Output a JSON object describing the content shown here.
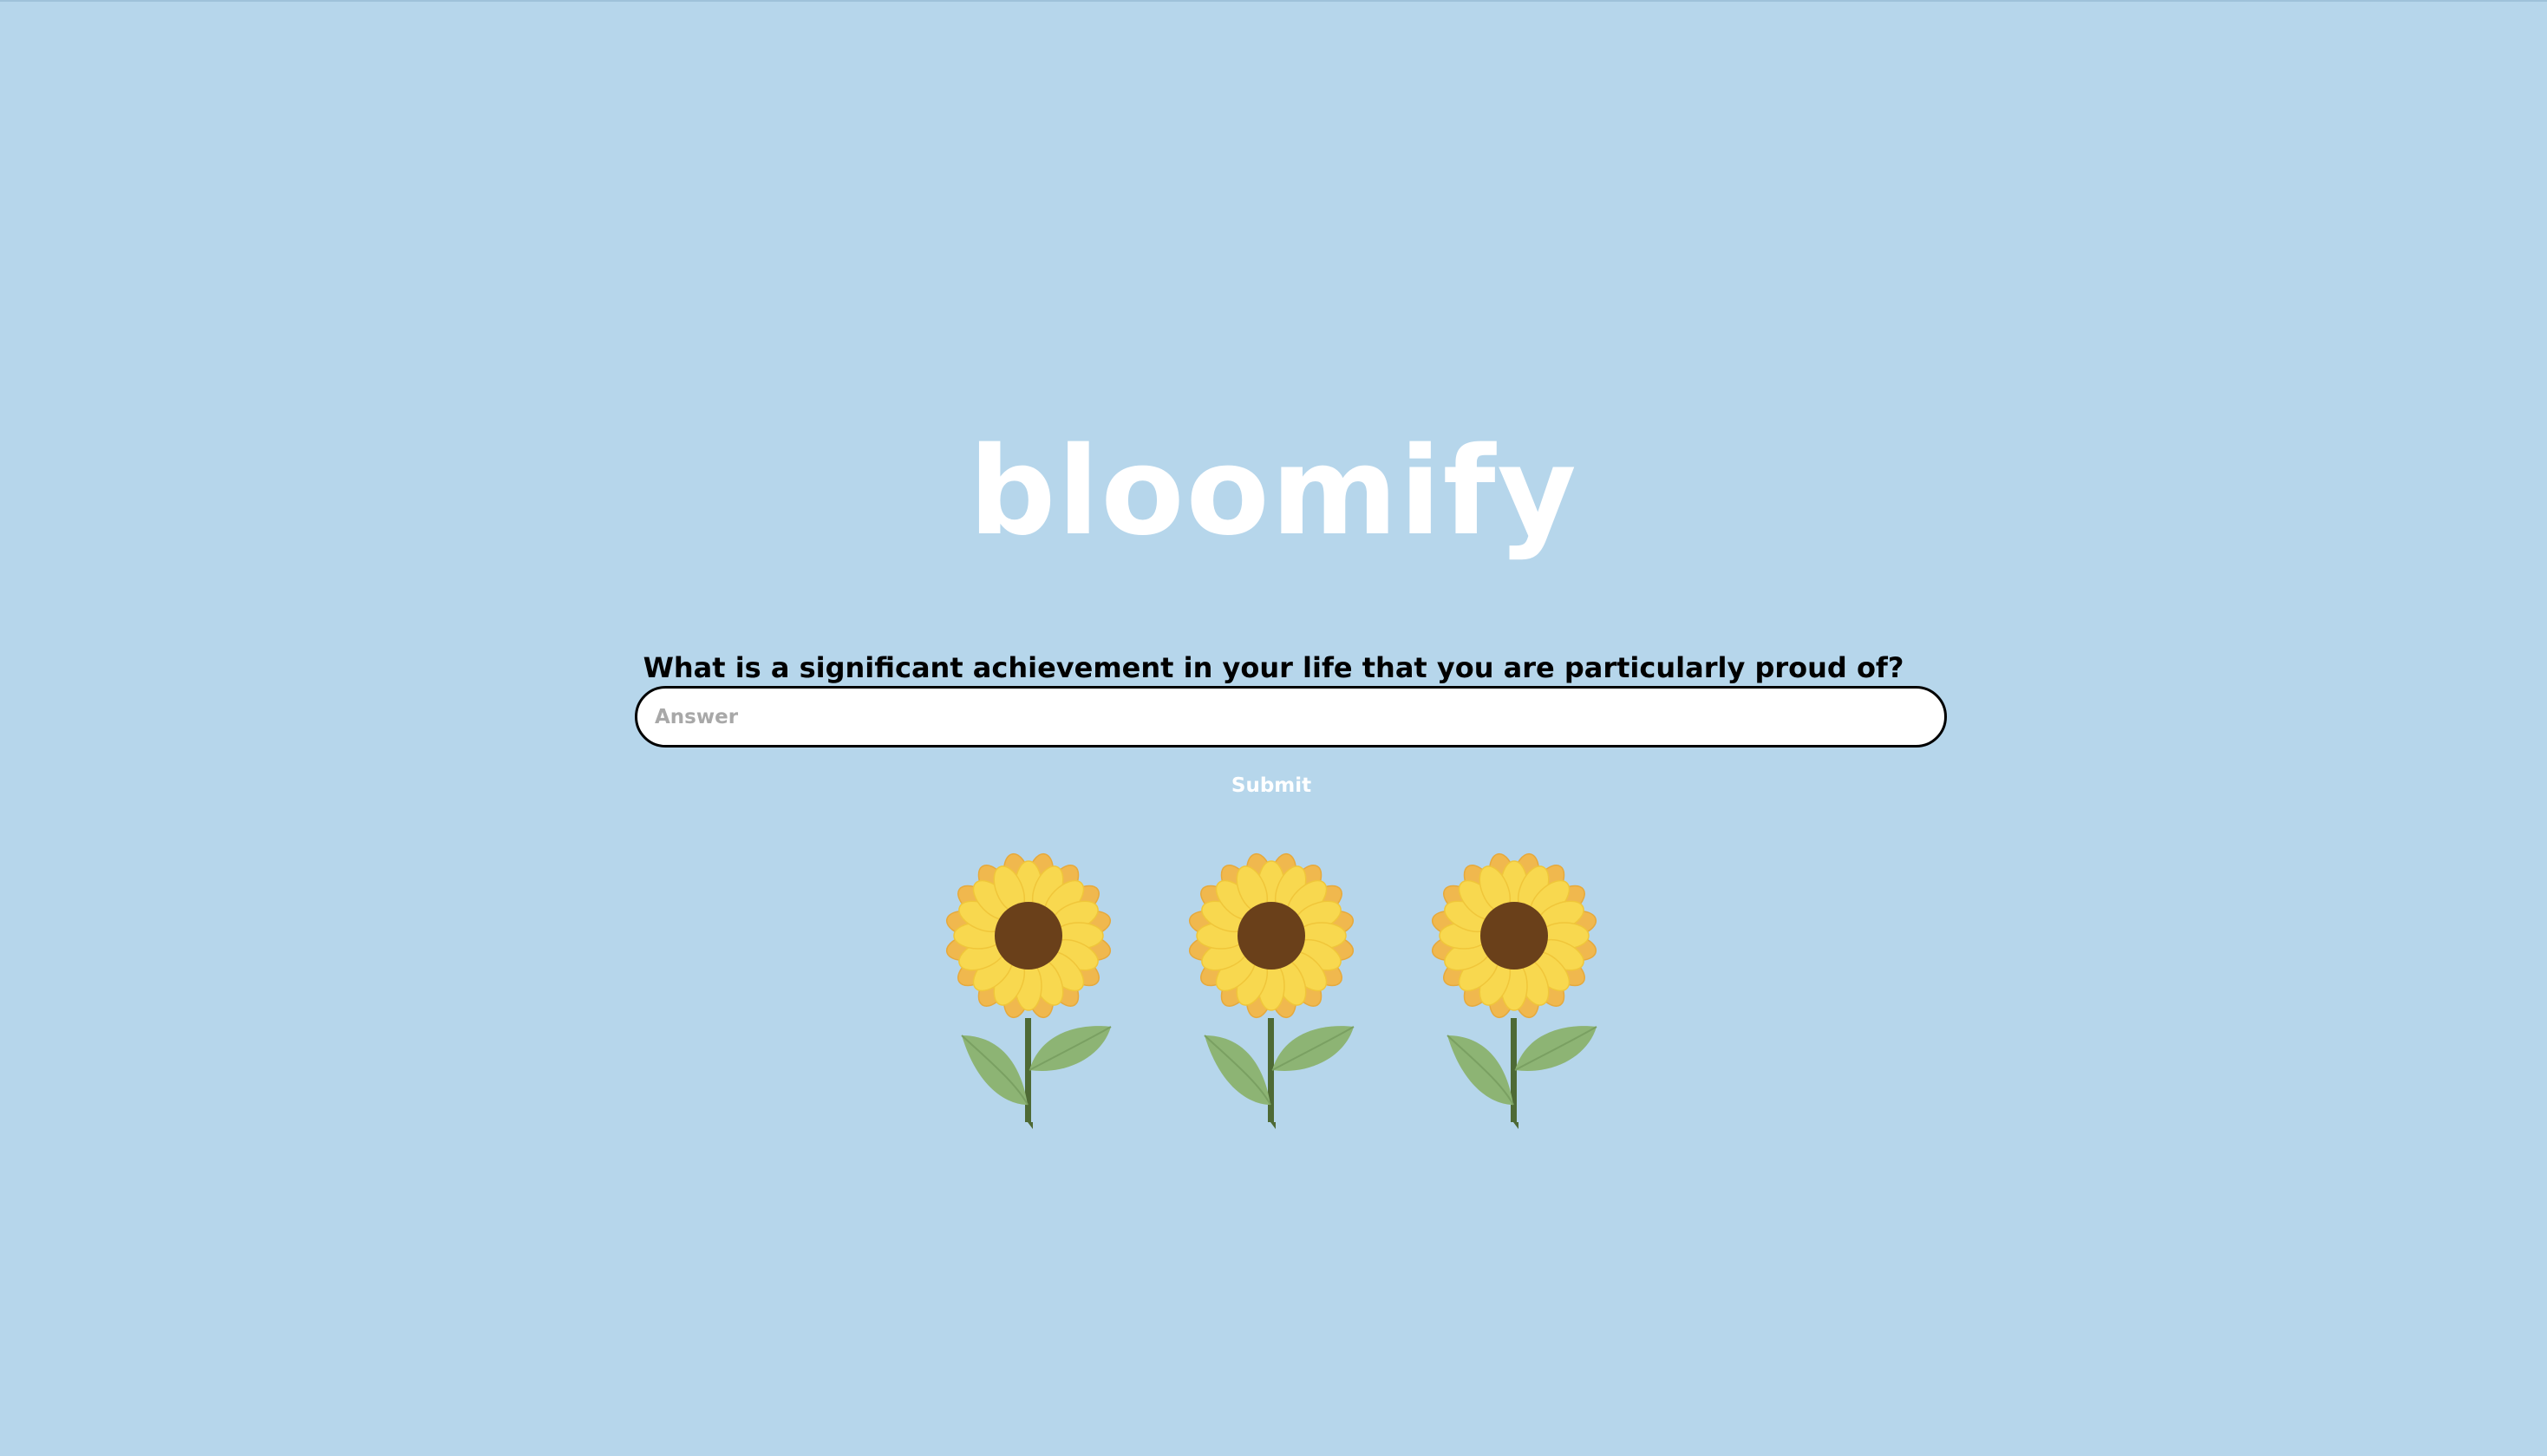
{
  "app": {
    "logo_text": "bloomify"
  },
  "form": {
    "question": "What is a significant achievement in your life that you are particularly proud of?",
    "answer_value": "",
    "answer_placeholder": "Answer",
    "submit_label": "Submit"
  },
  "flowers": [
    {
      "icon": "sunflower-icon"
    },
    {
      "icon": "sunflower-icon"
    },
    {
      "icon": "sunflower-icon"
    }
  ],
  "colors": {
    "background": "#b6d6eb",
    "logo": "#ffffff",
    "petal_inner": "#f8d84f",
    "petal_outer": "#f0b84e",
    "center": "#6a401a",
    "leaf": "#8db474",
    "stem": "#4e6a35"
  }
}
